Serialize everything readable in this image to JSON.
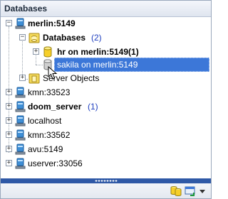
{
  "panel": {
    "title": "Databases"
  },
  "tree": {
    "root": {
      "label": "merlin:5149",
      "expander": "−"
    },
    "databases": {
      "label": "Databases",
      "count": "(2)",
      "expander": "−"
    },
    "db_hr": {
      "label": "hr on merlin:5149(1)",
      "expander": "+"
    },
    "db_sakila": {
      "label": "sakila on merlin:5149"
    },
    "server_objects": {
      "label": "Server Objects",
      "expander": "+"
    },
    "servers": [
      {
        "label": "kmn:33523",
        "bold": false,
        "count": "",
        "expander": "+"
      },
      {
        "label": "doom_server",
        "bold": true,
        "count": "(1)",
        "expander": "+"
      },
      {
        "label": "localhost",
        "bold": false,
        "count": "",
        "expander": "+"
      },
      {
        "label": "kmn:33562",
        "bold": false,
        "count": "",
        "expander": "+"
      },
      {
        "label": "avu:5149",
        "bold": false,
        "count": "",
        "expander": "+"
      },
      {
        "label": "userver:33056",
        "bold": false,
        "count": "",
        "expander": "+"
      }
    ]
  },
  "toolbar": {
    "buttons": [
      "database-group-icon",
      "refresh-connection-icon",
      "dropdown-arrow-icon"
    ]
  },
  "colors": {
    "selection": "#3c77d8",
    "splitter": "#2f59a6",
    "count": "#1f3fbf"
  }
}
